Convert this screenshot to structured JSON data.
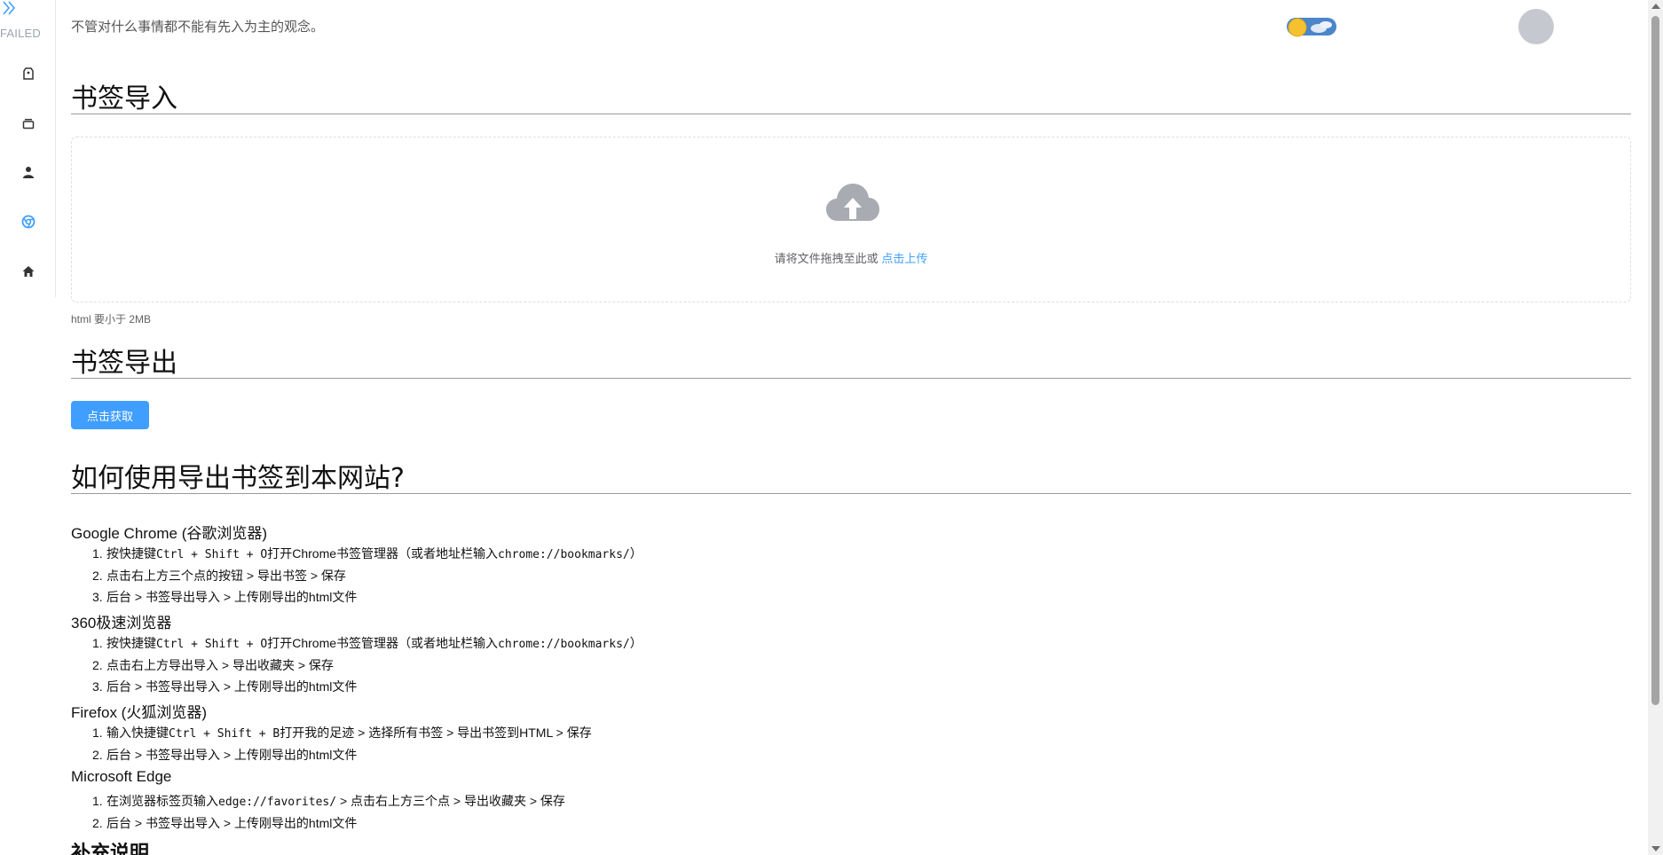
{
  "sidebar": {
    "status": "FAILED",
    "icons": [
      "tag-icon",
      "archive-icon",
      "user-icon",
      "chrome-icon",
      "home-icon"
    ]
  },
  "header": {
    "motto": "不管对什么事情都不能有先入为主的观念。"
  },
  "import_section": {
    "title": "书签导入",
    "upload_text": "请将文件拖拽至此或",
    "upload_link": "点击上传",
    "tip": "html 要小于 2MB"
  },
  "export_section": {
    "title": "书签导出",
    "button": "点击获取"
  },
  "howto_section": {
    "title": "如何使用导出书签到本网站?",
    "browsers": [
      {
        "name": "Google Chrome (谷歌浏览器)",
        "steps": [
          {
            "num": "1.",
            "pre": "按快捷键",
            "code": "Ctrl + Shift + O",
            "post": "打开Chrome书签管理器（或者地址栏输入",
            "code2": "chrome://bookmarks/",
            "end": "）"
          },
          {
            "num": "2.",
            "text": "点击右上方三个点的按钮 > 导出书签 > 保存"
          },
          {
            "num": "3.",
            "text": "后台 > 书签导出导入 > 上传刚导出的html文件"
          }
        ]
      },
      {
        "name": "360极速浏览器",
        "steps": [
          {
            "num": "1.",
            "pre": "按快捷键",
            "code": "Ctrl + Shift + O",
            "post": "打开Chrome书签管理器（或者地址栏输入",
            "code2": "chrome://bookmarks/",
            "end": "）"
          },
          {
            "num": "2.",
            "text": "点击右上方导出导入 > 导出收藏夹 > 保存"
          },
          {
            "num": "3.",
            "text": "后台 > 书签导出导入 > 上传刚导出的html文件"
          }
        ]
      },
      {
        "name": "Firefox (火狐浏览器)",
        "steps": [
          {
            "num": "1.",
            "pre": "输入快捷键",
            "code": "Ctrl + Shift + B",
            "post": "打开我的足迹 > 选择所有书签 > 导出书签到HTML > 保存"
          },
          {
            "num": "2.",
            "text": "后台 > 书签导出导入 > 上传刚导出的html文件"
          }
        ]
      },
      {
        "name": "Microsoft Edge",
        "steps": [
          {
            "num": "1.",
            "pre": "在浏览器标签页输入",
            "code": "edge://favorites/",
            "post": " > 点击右上方三个点 > 导出收藏夹 > 保存"
          },
          {
            "num": "2.",
            "text": "后台 > 书签导出导入 > 上传刚导出的html文件"
          }
        ]
      }
    ]
  },
  "extra_section": {
    "title": "补充说明"
  },
  "colors": {
    "primary": "#409eff",
    "sidebar_active": "#409eff",
    "avatar": "#c6c8cf"
  }
}
